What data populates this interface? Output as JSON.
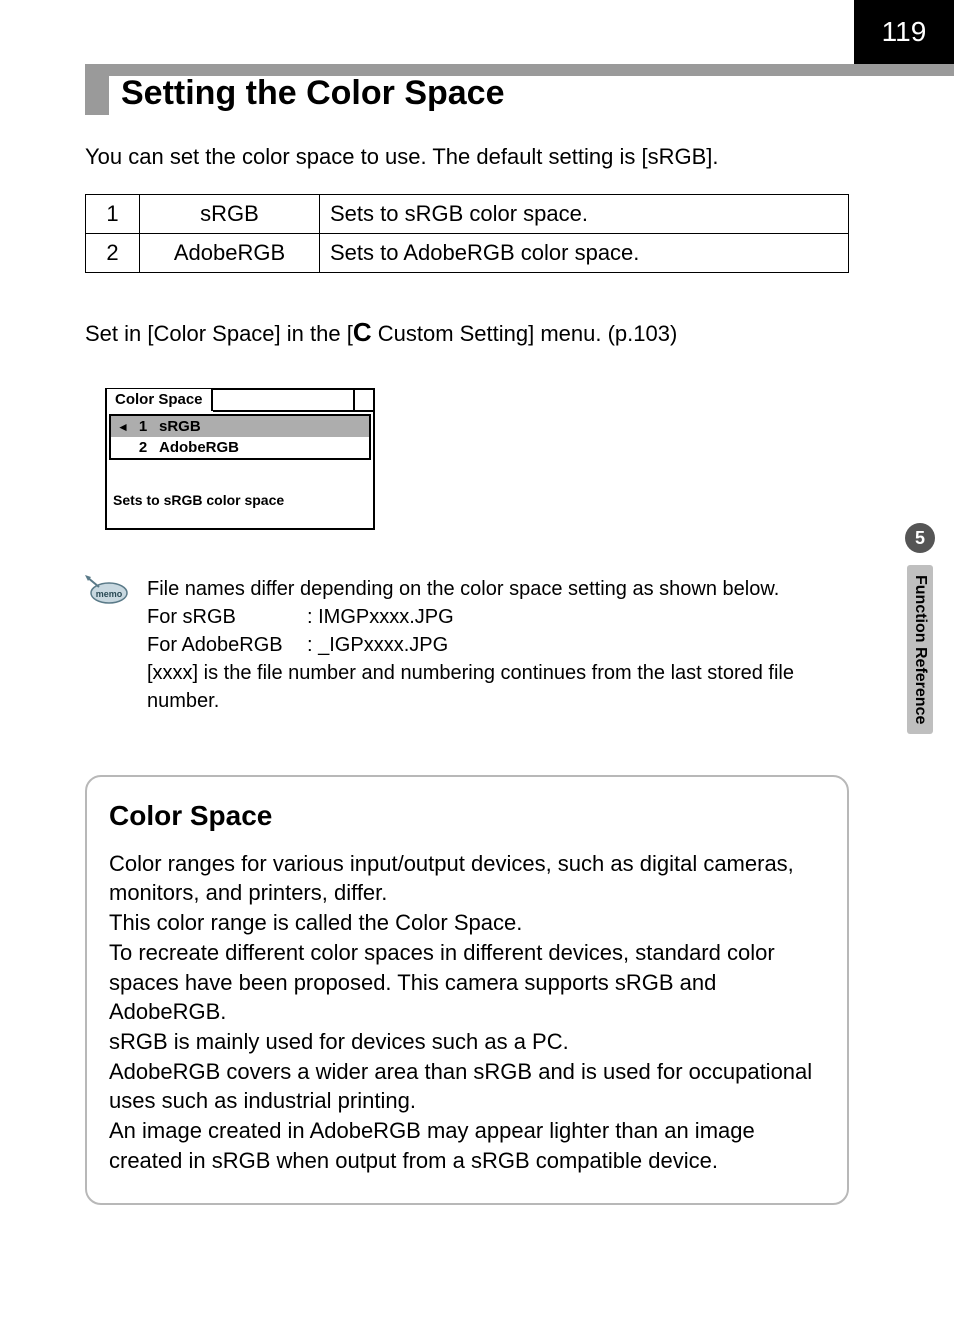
{
  "page_number": "119",
  "section_title": "Setting the Color Space",
  "intro_text": "You can set the color space to use. The default setting is [sRGB].",
  "options_table": [
    {
      "num": "1",
      "name": "sRGB",
      "desc": "Sets to sRGB color space."
    },
    {
      "num": "2",
      "name": "AdobeRGB",
      "desc": "Sets to AdobeRGB color space."
    }
  ],
  "setin_prefix": "Set in [Color Space] in the [",
  "setin_symbol": "C",
  "setin_suffix": " Custom Setting] menu. (p.103)",
  "menu_preview": {
    "tab_title": "Color Space",
    "rows": [
      {
        "num": "1",
        "label": "sRGB",
        "selected": true
      },
      {
        "num": "2",
        "label": "AdobeRGB",
        "selected": false
      }
    ],
    "description": "Sets to sRGB color space"
  },
  "memo": {
    "line1": "File names differ depending on the color space setting as shown below.",
    "srgb_label": "For sRGB",
    "srgb_value": ": IMGPxxxx.JPG",
    "adobe_label": "For AdobeRGB",
    "adobe_value": ": _IGPxxxx.JPG",
    "line4": "[xxxx] is the file number and numbering continues from the last stored file number."
  },
  "info_box": {
    "heading": "Color Space",
    "p1": "Color ranges for various input/output devices, such as digital cameras, monitors, and printers, differ.",
    "p2": "This color range is called the Color Space.",
    "p3": "To recreate different color spaces in different devices, standard color spaces have been proposed. This camera supports sRGB and AdobeRGB.",
    "p4": "sRGB is mainly used for devices such as a PC.",
    "p5": "AdobeRGB covers a wider area than sRGB and is used for occupational uses such as industrial printing.",
    "p6": "An image created in AdobeRGB may appear lighter than an image created in sRGB when output from a sRGB compatible device."
  },
  "side_tab": {
    "number": "5",
    "label": "Function Reference"
  }
}
